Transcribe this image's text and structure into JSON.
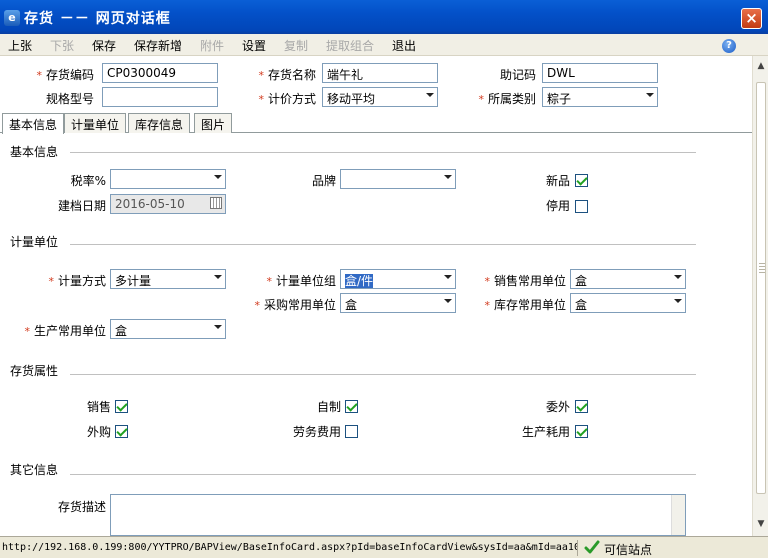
{
  "window": {
    "title": "存货 －－ 网页对话框",
    "icon": "ie-page-icon",
    "close_label": "×"
  },
  "toolbar": [
    {
      "label": "上张",
      "enabled": true
    },
    {
      "label": "下张",
      "enabled": false
    },
    {
      "label": "保存",
      "enabled": true
    },
    {
      "label": "保存新增",
      "enabled": true
    },
    {
      "label": "附件",
      "enabled": false
    },
    {
      "label": "设置",
      "enabled": true
    },
    {
      "label": "复制",
      "enabled": false
    },
    {
      "label": "提取组合",
      "enabled": false
    },
    {
      "label": "退出",
      "enabled": true
    }
  ],
  "help": {
    "glyph": "?"
  },
  "header_fields": {
    "code": {
      "label": "存货编码",
      "value": "CP0300049",
      "required": true
    },
    "name": {
      "label": "存货名称",
      "value": "端午礼",
      "required": true
    },
    "mnemonic": {
      "label": "助记码",
      "value": "DWL"
    },
    "spec": {
      "label": "规格型号",
      "value": ""
    },
    "pricing": {
      "label": "计价方式",
      "value": "移动平均",
      "required": true
    },
    "category": {
      "label": "所属类别",
      "value": "粽子",
      "required": true
    }
  },
  "tabs": [
    "基本信息",
    "计量单位",
    "库存信息",
    "图片"
  ],
  "basic": {
    "title": "基本信息",
    "tax_rate": {
      "label": "税率%",
      "value": ""
    },
    "brand": {
      "label": "品牌",
      "value": ""
    },
    "new_product": {
      "label": "新品",
      "checked": true
    },
    "created_date": {
      "label": "建档日期",
      "value": "2016-05-10"
    },
    "disabled": {
      "label": "停用",
      "checked": false
    }
  },
  "units": {
    "title": "计量单位",
    "method": {
      "label": "计量方式",
      "value": "多计量"
    },
    "unit_group": {
      "label": "计量单位组",
      "value": "盒/件"
    },
    "sales_unit": {
      "label": "销售常用单位",
      "value": "盒"
    },
    "purchase_unit": {
      "label": "采购常用单位",
      "value": "盒"
    },
    "stock_unit": {
      "label": "库存常用单位",
      "value": "盒"
    },
    "production_unit": {
      "label": "生产常用单位",
      "value": "盒"
    }
  },
  "attributes": {
    "title": "存货属性",
    "items": [
      {
        "label": "销售",
        "checked": true
      },
      {
        "label": "自制",
        "checked": true
      },
      {
        "label": "委外",
        "checked": true
      },
      {
        "label": "外购",
        "checked": true
      },
      {
        "label": "劳务费用",
        "checked": false
      },
      {
        "label": "生产耗用",
        "checked": true
      }
    ]
  },
  "other": {
    "title": "其它信息",
    "description_label": "存货描述",
    "description_value": ""
  },
  "status": {
    "url": "http://192.168.0.199:800/YYTPRO/BAPView/BaseInfoCard.aspx?pId=baseInfoCardView&sysId=aa&mId=aa105",
    "zone": "可信站点"
  },
  "colors": {
    "title_bar": "#0350c8",
    "required_star": "#d23a1e",
    "check": "#21a121",
    "selection": "#316ac5"
  }
}
